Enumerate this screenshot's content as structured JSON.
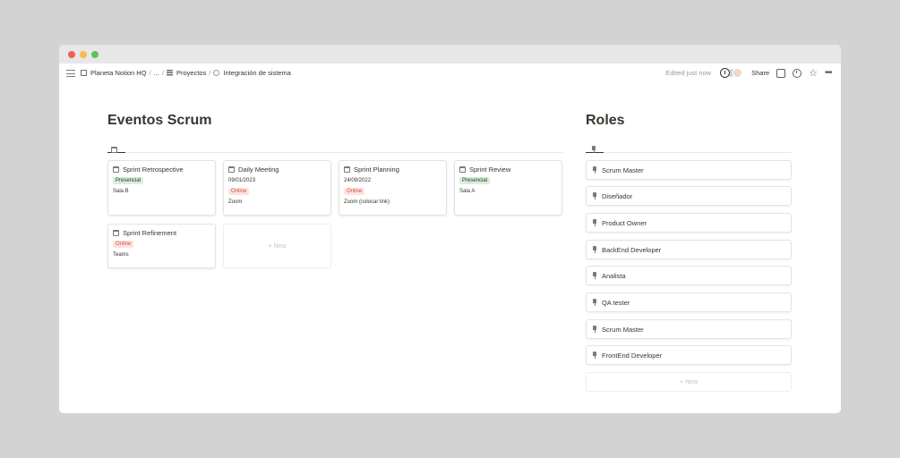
{
  "breadcrumb": {
    "items": [
      {
        "label": "Planeta Notion HQ",
        "icon": "book-icon"
      },
      {
        "label": "...",
        "icon": ""
      },
      {
        "label": "Proyectos",
        "icon": "database-icon"
      },
      {
        "label": "Integración de sistema",
        "icon": "gear-icon"
      }
    ]
  },
  "topbar": {
    "edited": "Edited just now",
    "share": "Share"
  },
  "events": {
    "title": "Eventos Scrum",
    "new_label": "+ New",
    "cards": [
      {
        "name": "Sprint Retrospective",
        "date": "",
        "mode": "Presencial",
        "mode_color": "green",
        "place": "Sala B"
      },
      {
        "name": "Daily Meeting",
        "date": "09/01/2023",
        "mode": "Online",
        "mode_color": "red",
        "place": "Zoom"
      },
      {
        "name": "Sprint Planning",
        "date": "24/09/2022",
        "mode": "Online",
        "mode_color": "red",
        "place": "Zoom (colocar link)"
      },
      {
        "name": "Sprint Review",
        "date": "",
        "mode": "Presencial",
        "mode_color": "green",
        "place": "Sala A"
      },
      {
        "name": "Sprint Refinement",
        "date": "",
        "mode": "Online",
        "mode_color": "red",
        "place": "Teams"
      }
    ]
  },
  "roles": {
    "title": "Roles",
    "new_label": "+ New",
    "items": [
      "Scrum Master",
      "Diseñador",
      "Product Owner",
      "BackEnd Developer",
      "Analista",
      "QA tester",
      "Scrum Master",
      "FrontEnd Developer"
    ]
  },
  "colors": {
    "tag_green_bg": "#dbeddb",
    "tag_red_bg": "#ffe2dd",
    "tag_red_text": "#c4554d"
  }
}
